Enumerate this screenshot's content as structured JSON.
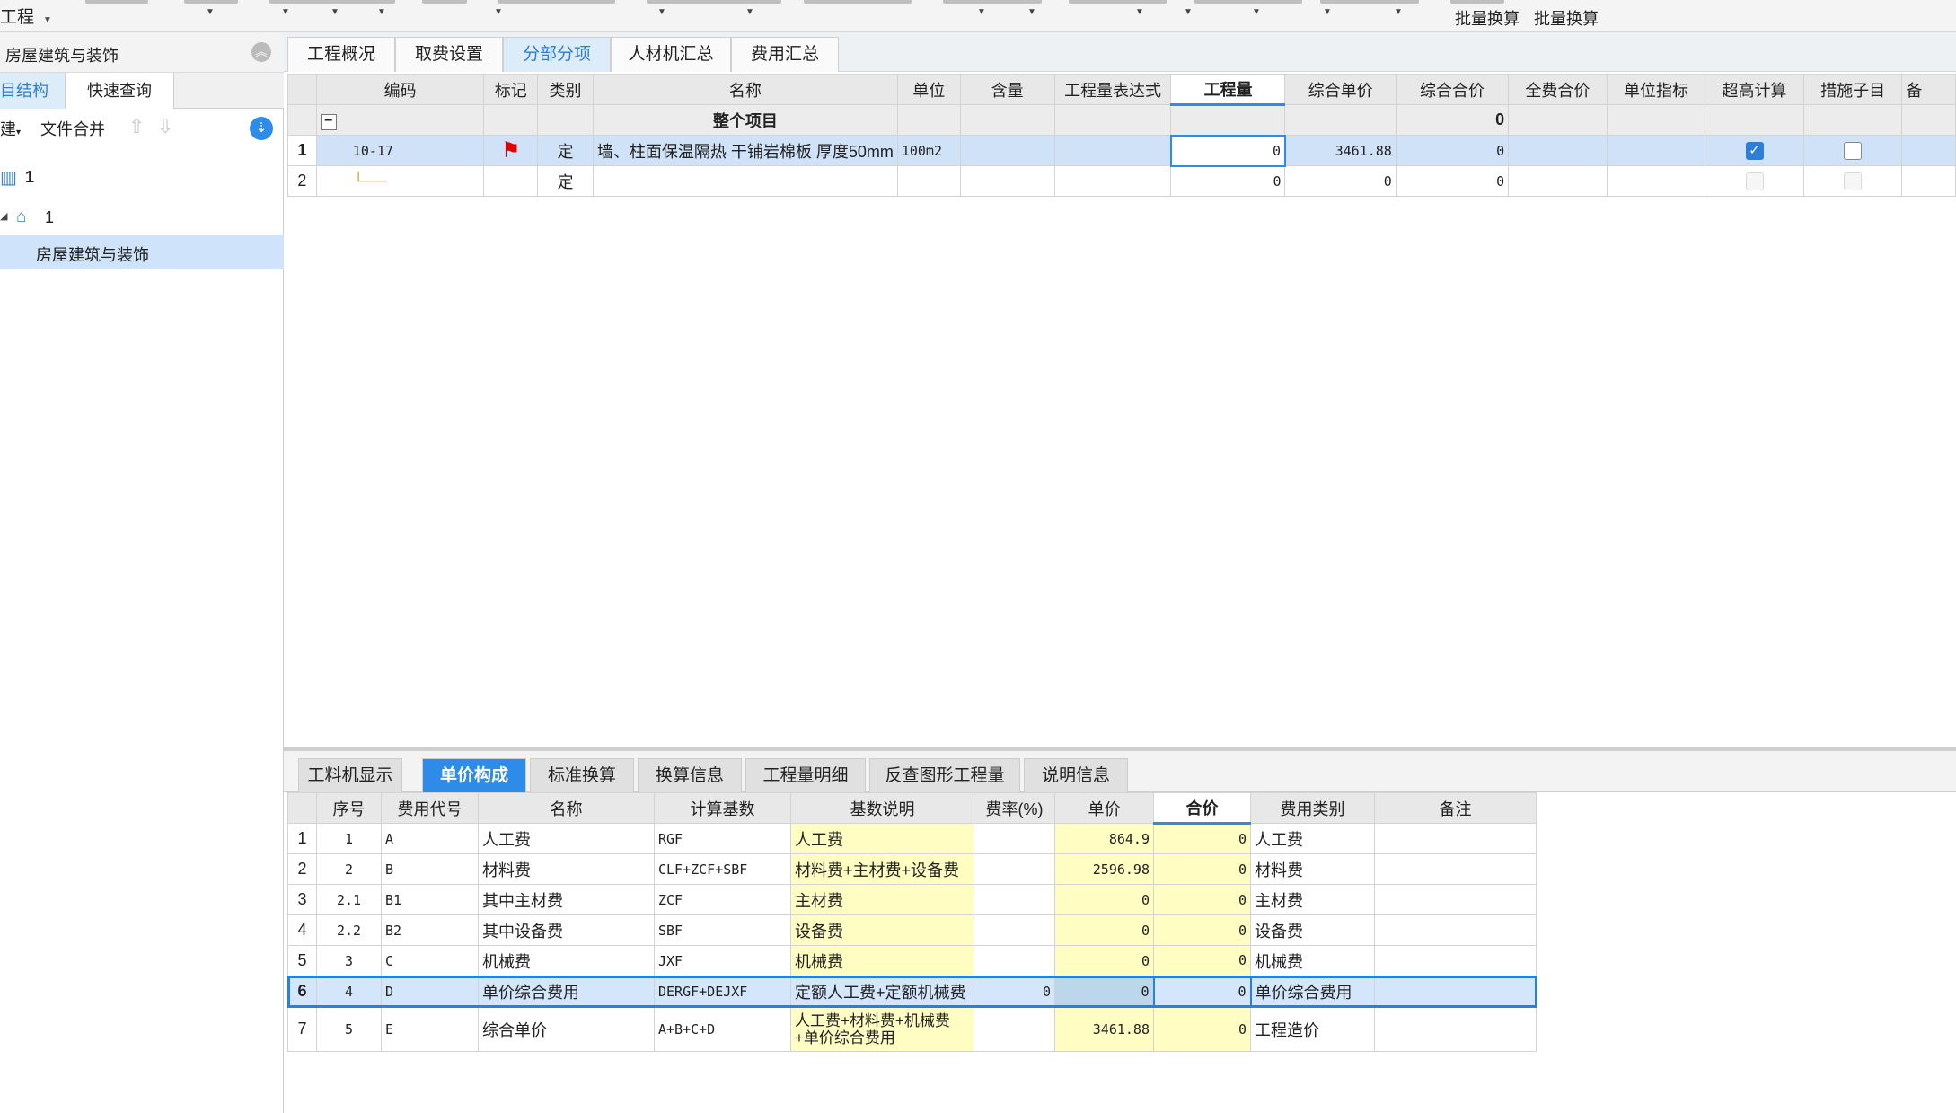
{
  "ribbon": {
    "first_label": "工程",
    "batch_labels": [
      "批量换算",
      "批量换算"
    ]
  },
  "left_panel": {
    "title": "房屋建筑与装饰",
    "tabs": [
      "目结构",
      "快速查询"
    ],
    "tool_new": "建",
    "tool_merge": "文件合并",
    "tree": [
      {
        "label": "1"
      },
      {
        "label": "1"
      },
      {
        "label": "房屋建筑与装饰"
      }
    ]
  },
  "main_tabs": [
    "工程概况",
    "取费设置",
    "分部分项",
    "人材机汇总",
    "费用汇总"
  ],
  "grid": {
    "columns": [
      "编码",
      "标记",
      "类别",
      "名称",
      "单位",
      "含量",
      "工程量表达式",
      "工程量",
      "综合单价",
      "综合合价",
      "全费合价",
      "单位指标",
      "超高计算",
      "措施子目",
      "备"
    ],
    "group": {
      "label": "整个项目",
      "total": "0"
    },
    "rows": [
      {
        "no": "1",
        "code": "10-17",
        "type": "定",
        "name": "墙、柱面保温隔热 干铺岩棉板 厚度50mm",
        "unit": "100m2",
        "qty": "0",
        "unit_price": "3461.88",
        "total": "0"
      },
      {
        "no": "2",
        "code": "",
        "type": "定",
        "name": "",
        "unit": "",
        "qty": "0",
        "unit_price": "0",
        "total": "0"
      }
    ]
  },
  "bottom_tabs": [
    "工料机显示",
    "单价构成",
    "标准换算",
    "换算信息",
    "工程量明细",
    "反查图形工程量",
    "说明信息"
  ],
  "bottom_grid": {
    "columns": [
      "序号",
      "费用代号",
      "名称",
      "计算基数",
      "基数说明",
      "费率(%)",
      "单价",
      "合价",
      "费用类别",
      "备注"
    ],
    "rows": [
      {
        "n": "1",
        "seq": "1",
        "code": "A",
        "name": "人工费",
        "base": "RGF",
        "desc": "人工费",
        "rate": "",
        "price": "864.9",
        "total": "0",
        "cat": "人工费",
        "note": ""
      },
      {
        "n": "2",
        "seq": "2",
        "code": "B",
        "name": "材料费",
        "base": "CLF+ZCF+SBF",
        "desc": "材料费+主材费+设备费",
        "rate": "",
        "price": "2596.98",
        "total": "0",
        "cat": "材料费",
        "note": ""
      },
      {
        "n": "3",
        "seq": "2.1",
        "code": "B1",
        "name": "其中主材费",
        "base": "ZCF",
        "desc": "主材费",
        "rate": "",
        "price": "0",
        "total": "0",
        "cat": "主材费",
        "note": ""
      },
      {
        "n": "4",
        "seq": "2.2",
        "code": "B2",
        "name": "其中设备费",
        "base": "SBF",
        "desc": "设备费",
        "rate": "",
        "price": "0",
        "total": "0",
        "cat": "设备费",
        "note": ""
      },
      {
        "n": "5",
        "seq": "3",
        "code": "C",
        "name": "机械费",
        "base": "JXF",
        "desc": "机械费",
        "rate": "",
        "price": "0",
        "total": "0",
        "cat": "机械费",
        "note": ""
      },
      {
        "n": "6",
        "seq": "4",
        "code": "D",
        "name": "单价综合费用",
        "base": "DERGF+DEJXF",
        "desc": "定额人工费+定额机械费",
        "rate": "0",
        "price": "0",
        "total": "0",
        "cat": "单价综合费用",
        "note": ""
      },
      {
        "n": "7",
        "seq": "5",
        "code": "E",
        "name": "综合单价",
        "base": "A+B+C+D",
        "desc": "人工费+材料费+机械费",
        "desc2": "+单价综合费用",
        "rate": "",
        "price": "3461.88",
        "total": "0",
        "cat": "工程造价",
        "note": ""
      }
    ]
  }
}
